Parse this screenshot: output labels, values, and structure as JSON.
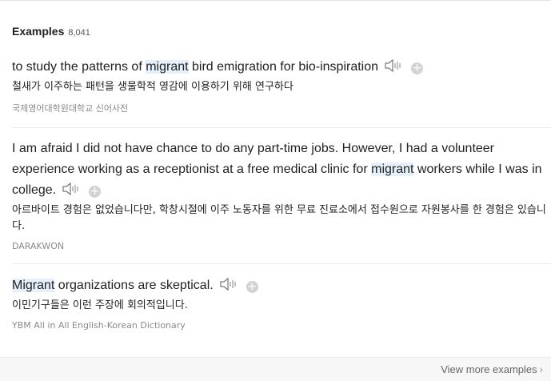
{
  "header": {
    "title": "Examples",
    "count": "8,041"
  },
  "examples": [
    {
      "en_before": "to study the patterns of ",
      "en_highlight": "migrant",
      "en_after": " bird emigration for bio-inspiration",
      "ko": "철새가 이주하는 패턴을 생물학적 영감에 이용하기 위해 연구하다",
      "source": "국제영어대학원대학교 신어사전"
    },
    {
      "en_before": "I am afraid I did not have chance to do any part-time jobs. However, I had a volunteer experience working as a receptionist at a free medical clinic for ",
      "en_highlight": "migrant",
      "en_after": " workers while I was in college.",
      "ko": "아르바이트 경험은 없었습니다만, 학창시절에 이주 노동자를 위한 무료 진료소에서 접수원으로 자원봉사를 한 경험은 있습니다.",
      "source": "DARAKWON"
    },
    {
      "en_before": "",
      "en_highlight": "Migrant",
      "en_after": " organizations are skeptical.",
      "ko": "이민기구들은 이런 주장에 회의적입니다.",
      "source": "YBM All in All English-Korean Dictionary"
    }
  ],
  "footer": {
    "view_more": "View more examples",
    "chevron": "›"
  },
  "icons": {
    "speaker": "speaker-icon",
    "add": "add-icon"
  },
  "colors": {
    "highlight": "#e6f0fa",
    "source_text": "#8a8a8a"
  }
}
